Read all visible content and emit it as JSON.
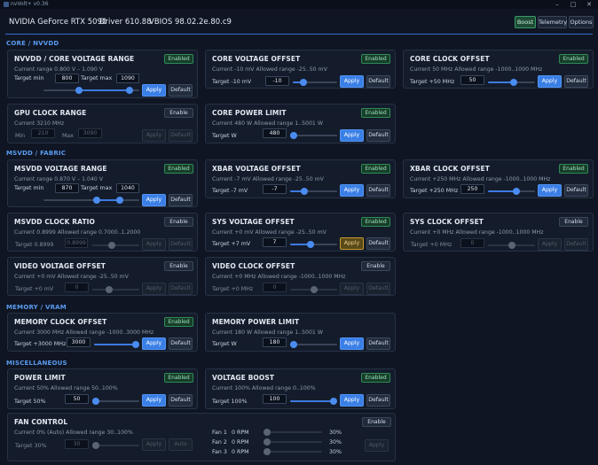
{
  "window": {
    "app_title": "nvVolt+ v0.36"
  },
  "header": {
    "gpu": "NVIDIA GeForce RTX 5090",
    "driver": "Driver 610.88",
    "vbios": "VBIOS 98.02.2e.80.c9",
    "buttons": {
      "boost": "Boost",
      "telemetry": "Telemetry",
      "options": "Options"
    }
  },
  "common": {
    "apply": "Apply",
    "default": "Default",
    "auto": "Auto",
    "enabled": "Enabled",
    "enable": "Enable"
  },
  "sections": {
    "nvvdd": "CORE / NVVDD",
    "msvdd": "MSVDD / FABRIC",
    "memory": "MEMORY / VRAM",
    "misc": "MISCELLANEOUS"
  },
  "cards": {
    "core_vrange": {
      "title": "NVVDD / CORE VOLTAGE RANGE",
      "sub": "Current range 0.800 V – 1.090 V",
      "min_label": "Target min",
      "min_value": "800",
      "max_label": "Target max",
      "max_value": "1090",
      "lo": 0.36,
      "hi": 0.93
    },
    "core_voffset": {
      "title": "CORE VOLTAGE OFFSET",
      "sub": "Current -10 mV   Allowed range -25..50 mV",
      "target": "Target -10 mV",
      "value": "-10",
      "level": 0.2
    },
    "core_clock": {
      "title": "CORE CLOCK OFFSET",
      "sub": "Current 50 MHz   Allowed range -1000..1000 MHz",
      "target": "Target +50 MHz",
      "value": "50",
      "level": 0.56
    },
    "gpu_clock_range": {
      "title": "GPU CLOCK RANGE",
      "sub": "Current 3210 MHz",
      "min_label": "Min",
      "min_value": "210",
      "max_label": "Max",
      "max_value": "3090"
    },
    "core_power": {
      "title": "CORE POWER LIMIT",
      "sub": "Current 480 W   Allowed range 1..5001 W",
      "target": "Target W",
      "value": "480",
      "level": 0
    },
    "msvdd_vrange": {
      "title": "MSVDD VOLTAGE RANGE",
      "sub": "Current range 0.870 V – 1.040 V",
      "min_label": "Target min",
      "min_value": "870",
      "max_label": "Target max",
      "max_value": "1040",
      "lo": 0.56,
      "hi": 0.82
    },
    "xbar_voffset": {
      "title": "XBAR VOLTAGE OFFSET",
      "sub": "Current -7 mV   Allowed range -25..50 mV",
      "target": "Target -7 mV",
      "value": "-7",
      "level": 0.27
    },
    "xbar_clock": {
      "title": "XBAR CLOCK OFFSET",
      "sub": "Current +250 MHz   Allowed range -1000..1000 MHz",
      "target": "Target +250 MHz",
      "value": "250",
      "level": 0.62
    },
    "msvdd_ratio": {
      "title": "MSVDD CLOCK RATIO",
      "sub": "Current 0.8999   Allowed range 0.7000..1.2000",
      "target": "Target 0.8999",
      "value": "0.8999",
      "level": 0.4
    },
    "sys_voffset": {
      "title": "SYS VOLTAGE OFFSET",
      "sub": "Current +0 mV   Allowed range -25..50 mV",
      "target": "Target +7 mV",
      "value": "7",
      "level": 0.43
    },
    "sys_clock": {
      "title": "SYS CLOCK OFFSET",
      "sub": "Current +0 MHz   Allowed range -1000..1000 MHz",
      "target": "Target +0 MHz",
      "value": "0",
      "level": 0.5
    },
    "video_voffset": {
      "title": "VIDEO VOLTAGE OFFSET",
      "sub": "Current +0 mV   Allowed range -25..50 mV",
      "target": "Target +0 mV",
      "value": "0",
      "level": 0.33
    },
    "video_clock": {
      "title": "VIDEO CLOCK OFFSET",
      "sub": "Current +0 MHz   Allowed range -1000..1000 MHz",
      "target": "Target +0 MHz",
      "value": "0",
      "level": 0.5
    },
    "mem_clock": {
      "title": "MEMORY CLOCK OFFSET",
      "sub": "Current 3000 MHz   Allowed range -1000..3000 MHz",
      "target": "Target +3000 MHz",
      "value": "3000",
      "level": 1.0
    },
    "mem_power": {
      "title": "MEMORY POWER LIMIT",
      "sub": "Current 180 W   Allowed range 1..5001 W",
      "target": "Target W",
      "value": "180",
      "level": 0
    },
    "power_limit": {
      "title": "POWER LIMIT",
      "sub": "Current 50%   Allowed range 50..100%",
      "target": "Target 50%",
      "value": "50",
      "level": 0
    },
    "voltage_boost": {
      "title": "VOLTAGE BOOST",
      "sub": "Current 100%   Allowed range 0..100%",
      "target": "Target 100%",
      "value": "100",
      "level": 1.0
    },
    "fan_control": {
      "title": "FAN CONTROL",
      "sub": "Current 0% (Auto)   Allowed range 30..100%",
      "target": "Target 30%",
      "value": "30",
      "level": 0,
      "fans": [
        {
          "label": "Fan 1",
          "rpm": "0 RPM",
          "pct": "30%"
        },
        {
          "label": "Fan 2",
          "rpm": "0 RPM",
          "pct": "30%"
        },
        {
          "label": "Fan 3",
          "rpm": "0 RPM",
          "pct": "30%"
        }
      ]
    }
  }
}
